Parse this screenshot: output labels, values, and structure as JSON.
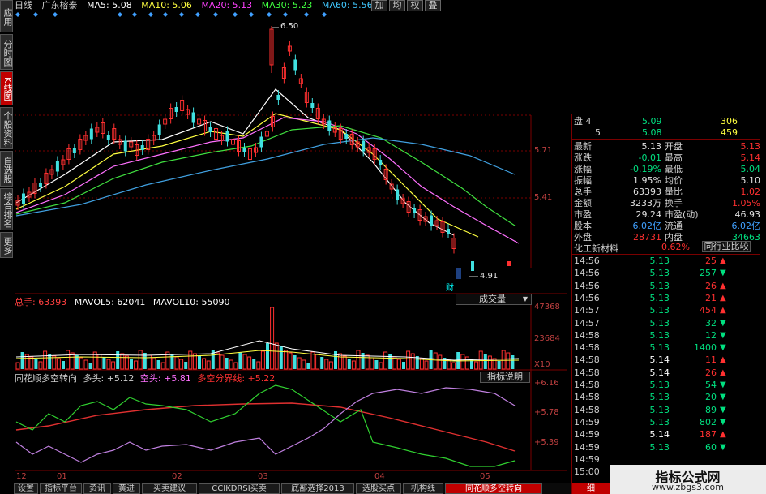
{
  "header": {
    "period": "日线",
    "stock_name": "广东榕泰",
    "ma5": "MA5: 5.08",
    "ma10": "MA10: 5.06",
    "ma20": "MA20: 5.13",
    "ma30": "MA30: 5.23",
    "ma60": "MA60: 5.56",
    "btn_add": "加",
    "btn_avg": "均",
    "btn_weight": "权",
    "btn_overlay": "叠"
  },
  "sidebar": [
    {
      "label": "应用"
    },
    {
      "label": "分时图"
    },
    {
      "label": "K线图"
    },
    {
      "label": "个股资料"
    },
    {
      "label": "自选股"
    },
    {
      "label": "综合排名"
    },
    {
      "label": "更多"
    }
  ],
  "price_axis": [
    "5.71",
    "5.41"
  ],
  "price_annotations": {
    "high": "6.50",
    "low": "4.91",
    "fin": "财"
  },
  "volume_header": {
    "label": "总手: 63393",
    "mavol5": "MAVOL5: 62041",
    "mavol10": "MAVOL10: 55090",
    "selector": "成交量"
  },
  "volume_axis": [
    "47368",
    "23684",
    "X10"
  ],
  "indicator_header": {
    "name": "同花顺多空转向",
    "long": "多头: +5.12",
    "short": "空头: +5.81",
    "split": "多空分界线: +5.22",
    "explain_btn": "指标说明"
  },
  "indicator_axis": [
    "+6.16",
    "+5.78",
    "+5.39"
  ],
  "date_axis": [
    "12",
    "01",
    "02",
    "03",
    "04",
    "05"
  ],
  "bottom_tabs": [
    "设置",
    "指标平台",
    "资讯",
    "黄进",
    "买卖建议",
    "CCIKDRSI买卖",
    "底部选择2013",
    "选股买点",
    "机构线",
    "同花顺多空转向"
  ],
  "quote": {
    "bid_rows": [
      {
        "label": "盘 4",
        "price": "5.09",
        "vol": "306"
      },
      {
        "label": "5",
        "price": "5.08",
        "vol": "459"
      }
    ],
    "fields": [
      {
        "l1": "最新",
        "v1": "5.13",
        "l2": "开盘",
        "v2": "5.13"
      },
      {
        "l1": "涨跌",
        "v1": "-0.01",
        "l2": "最高",
        "v2": "5.14"
      },
      {
        "l1": "涨幅",
        "v1": "-0.19%",
        "l2": "最低",
        "v2": "5.04"
      },
      {
        "l1": "振幅",
        "v1": "1.95%",
        "l2": "均价",
        "v2": "5.10"
      },
      {
        "l1": "总手",
        "v1": "63393",
        "l2": "量比",
        "v2": "1.02"
      },
      {
        "l1": "金额",
        "v1": "3233万",
        "l2": "换手",
        "v2": "1.05%"
      },
      {
        "l1": "市盈",
        "v1": "29.24",
        "l2": "市盈(动)",
        "v2": "46.93"
      },
      {
        "l1": "股本",
        "v1": "6.02亿",
        "l2": "流通",
        "v2": "6.02亿"
      },
      {
        "l1": "外盘",
        "v1": "28731",
        "l2": "内盘",
        "v2": "34663"
      }
    ],
    "industry": {
      "name": "化工新材料",
      "change": "0.62%",
      "compare_btn": "同行业比较"
    },
    "ticks": [
      {
        "t": "14:56",
        "p": "5.13",
        "v": "25",
        "d": "up"
      },
      {
        "t": "14:56",
        "p": "5.13",
        "v": "257",
        "d": "down"
      },
      {
        "t": "14:56",
        "p": "5.13",
        "v": "26",
        "d": "up"
      },
      {
        "t": "14:56",
        "p": "5.13",
        "v": "21",
        "d": "up"
      },
      {
        "t": "14:57",
        "p": "5.13",
        "v": "454",
        "d": "up"
      },
      {
        "t": "14:57",
        "p": "5.13",
        "v": "32",
        "d": "down"
      },
      {
        "t": "14:58",
        "p": "5.13",
        "v": "12",
        "d": "down"
      },
      {
        "t": "14:58",
        "p": "5.13",
        "v": "1400",
        "d": "down"
      },
      {
        "t": "14:58",
        "p": "5.14",
        "v": "11",
        "d": "up"
      },
      {
        "t": "14:58",
        "p": "5.14",
        "v": "26",
        "d": "up"
      },
      {
        "t": "14:58",
        "p": "5.13",
        "v": "54",
        "d": "down"
      },
      {
        "t": "14:58",
        "p": "5.13",
        "v": "20",
        "d": "down"
      },
      {
        "t": "14:58",
        "p": "5.13",
        "v": "89",
        "d": "down"
      },
      {
        "t": "14:59",
        "p": "5.13",
        "v": "802",
        "d": "down"
      },
      {
        "t": "14:59",
        "p": "5.14",
        "v": "187",
        "d": "up"
      },
      {
        "t": "14:59",
        "p": "5.13",
        "v": "60",
        "d": "down"
      },
      {
        "t": "14:59",
        "p": "",
        "v": "",
        "d": ""
      },
      {
        "t": "15:00",
        "p": "",
        "v": "",
        "d": ""
      }
    ],
    "bottom_label": "细"
  },
  "watermark": {
    "title": "指标公式网",
    "url": "www.zbgs3.com"
  },
  "colors": {
    "up": "#ff3030",
    "down": "#00d080",
    "bear_candle": "#40e0e0",
    "grid": "#7a0000",
    "cyan": "#00c8ff"
  }
}
